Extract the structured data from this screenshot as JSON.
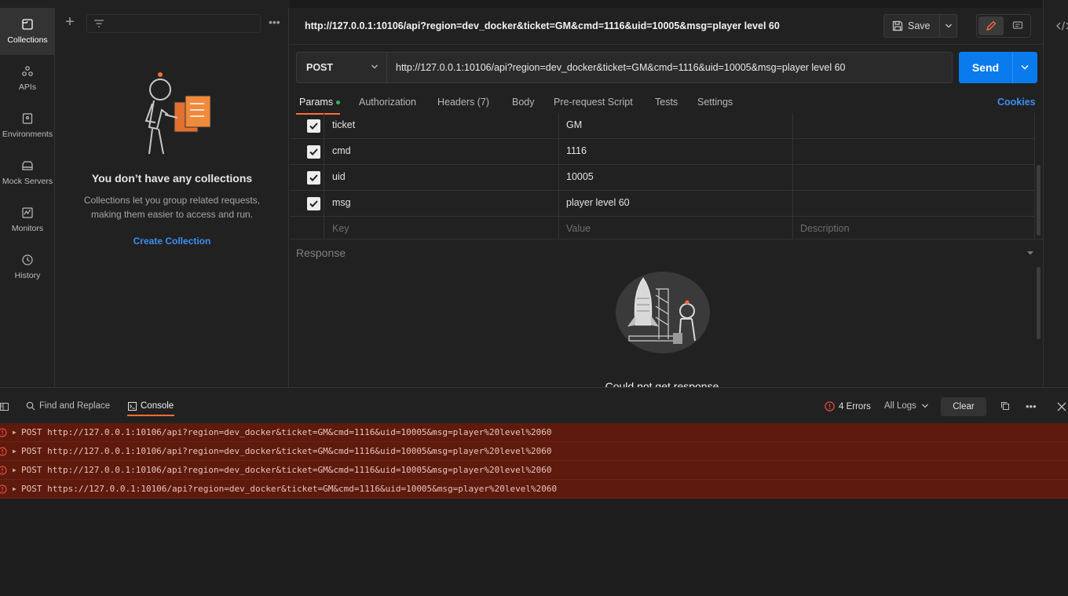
{
  "rail": {
    "items": [
      {
        "label": "Collections",
        "icon": "collections-icon",
        "active": true
      },
      {
        "label": "APIs",
        "icon": "apis-icon"
      },
      {
        "label": "Environments",
        "icon": "environments-icon"
      },
      {
        "label": "Mock Servers",
        "icon": "mock-servers-icon"
      },
      {
        "label": "Monitors",
        "icon": "monitors-icon"
      },
      {
        "label": "History",
        "icon": "history-icon"
      }
    ]
  },
  "sidebar": {
    "empty_title": "You don’t have any collections",
    "empty_desc": "Collections let you group related requests, making them easier to access and run.",
    "create_link": "Create Collection"
  },
  "request": {
    "title": "http://127.0.0.1:10106/api?region=dev_docker&ticket=GM&cmd=1116&uid=10005&msg=player level 60",
    "save_label": "Save",
    "method": "POST",
    "url": "http://127.0.0.1:10106/api?region=dev_docker&ticket=GM&cmd=1116&uid=10005&msg=player level 60",
    "send_label": "Send",
    "tabs": {
      "params": "Params",
      "authorization": "Authorization",
      "headers": "Headers (7)",
      "body": "Body",
      "prerequest": "Pre-request Script",
      "tests": "Tests",
      "settings": "Settings"
    },
    "cookies_label": "Cookies",
    "params": [
      {
        "key": "ticket",
        "value": "GM",
        "checked": true
      },
      {
        "key": "cmd",
        "value": "1116",
        "checked": true
      },
      {
        "key": "uid",
        "value": "10005",
        "checked": true
      },
      {
        "key": "msg",
        "value": "player level 60",
        "checked": true
      }
    ],
    "placeholder": {
      "key": "Key",
      "value": "Value",
      "description": "Description"
    }
  },
  "response": {
    "label": "Response",
    "message": "Could not get response"
  },
  "console": {
    "find_label": "Find and Replace",
    "console_label": "Console",
    "errors_label": "4 Errors",
    "logs_filter": "All Logs",
    "clear_label": "Clear",
    "logs": [
      "POST http://127.0.0.1:10106/api?region=dev_docker&ticket=GM&cmd=1116&uid=10005&msg=player%20level%2060",
      "POST http://127.0.0.1:10106/api?region=dev_docker&ticket=GM&cmd=1116&uid=10005&msg=player%20level%2060",
      "POST http://127.0.0.1:10106/api?region=dev_docker&ticket=GM&cmd=1116&uid=10005&msg=player%20level%2060",
      "POST https://127.0.0.1:10106/api?region=dev_docker&ticket=GM&cmd=1116&uid=10005&msg=player%20level%2060"
    ]
  },
  "colors": {
    "accent": "#ff6c37",
    "send": "#097bed",
    "link": "#3b8ff2",
    "error_bg": "#5d1a0d",
    "error_icon": "#e5483e"
  }
}
